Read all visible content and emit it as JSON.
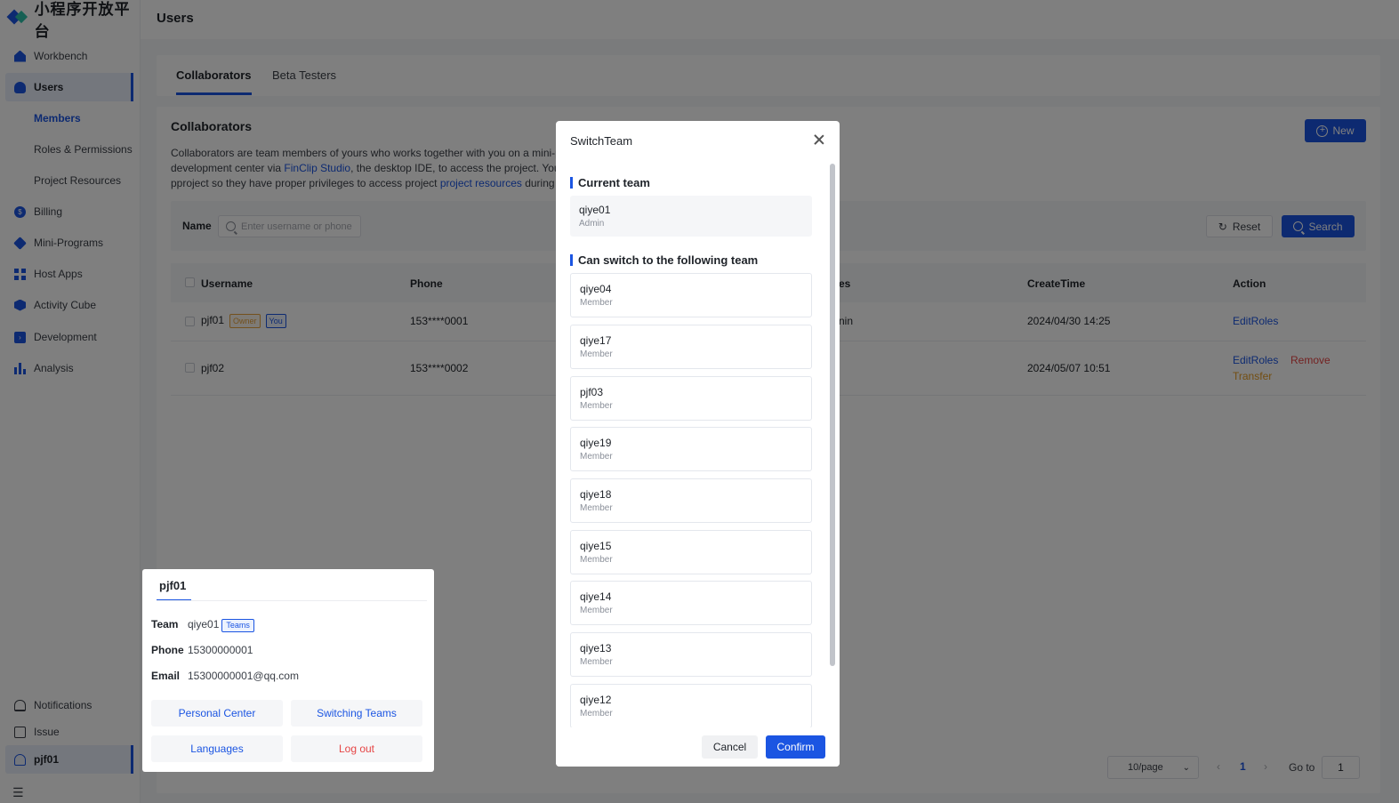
{
  "brand": {
    "name": "小程序开放平台"
  },
  "sidebar": {
    "items": [
      {
        "label": "Workbench",
        "icon": "home-icon"
      },
      {
        "label": "Users",
        "icon": "user-icon"
      },
      {
        "label": "Billing",
        "icon": "coin-icon"
      },
      {
        "label": "Mini-Programs",
        "icon": "diamond-icon"
      },
      {
        "label": "Host Apps",
        "icon": "grid-icon"
      },
      {
        "label": "Activity Cube",
        "icon": "cube-icon"
      },
      {
        "label": "Development",
        "icon": "terminal-icon"
      },
      {
        "label": "Analysis",
        "icon": "bar-chart-icon"
      }
    ],
    "sub_items": [
      "Members",
      "Roles & Permissions",
      "Project Resources"
    ],
    "bottom": [
      {
        "label": "Notifications",
        "icon": "bell-icon"
      },
      {
        "label": "Issue",
        "icon": "clipboard-icon"
      },
      {
        "label": "pjf01",
        "icon": "person-icon"
      }
    ]
  },
  "header": {
    "title": "Users"
  },
  "tabs": [
    "Collaborators",
    "Beta Testers"
  ],
  "collaborators": {
    "title": "Collaborators",
    "desc_1": "Collaborators are team members of yours who works together with you on a mini-p",
    "desc_2a": "development center via ",
    "desc_link1": "FinClip Studio",
    "desc_2b": ", the desktop IDE, to access the project. You",
    "desc_3a": "pproject so they have proper privileges to access project ",
    "desc_link2": "project resources",
    "desc_3b": " during t",
    "new_label": "New"
  },
  "filter": {
    "name_label": "Name",
    "placeholder": "Enter username or phone",
    "reset_label": "Reset",
    "search_label": "Search"
  },
  "table": {
    "headers": [
      "Username",
      "Phone",
      "es",
      "CreateTime",
      "Action"
    ],
    "rows": [
      {
        "username": "pjf01",
        "tag_owner": "Owner",
        "tag_you": "You",
        "phone": "153****0001",
        "role": "nin",
        "create_time": "2024/04/30 14:25",
        "action_edit": "EditRoles"
      },
      {
        "username": "pjf02",
        "phone": "153****0002",
        "create_time": "2024/05/07 10:51",
        "action_edit": "EditRoles",
        "action_remove": "Remove",
        "action_transfer": "Transfer"
      }
    ]
  },
  "pagination": {
    "page_size": "10/page",
    "prev": "‹",
    "current": "1",
    "next": "›",
    "goto_label": "Go to",
    "goto_value": "1"
  },
  "user_popover": {
    "name": "pjf01",
    "team_label": "Team",
    "team_value": "qiye01",
    "teams_tag": "Teams",
    "phone_label": "Phone",
    "phone_value": "15300000001",
    "email_label": "Email",
    "email_value": "15300000001@qq.com",
    "buttons": [
      "Personal Center",
      "Switching Teams",
      "Languages",
      "Log out"
    ]
  },
  "modal": {
    "title": "SwitchTeam",
    "current_section": "Current team",
    "current_team": {
      "name": "qiye01",
      "role": "Admin"
    },
    "switch_section": "Can switch to the following team",
    "teams": [
      {
        "name": "qiye04",
        "role": "Member"
      },
      {
        "name": "qiye17",
        "role": "Member"
      },
      {
        "name": "pjf03",
        "role": "Member"
      },
      {
        "name": "qiye19",
        "role": "Member"
      },
      {
        "name": "qiye18",
        "role": "Member"
      },
      {
        "name": "qiye15",
        "role": "Member"
      },
      {
        "name": "qiye14",
        "role": "Member"
      },
      {
        "name": "qiye13",
        "role": "Member"
      },
      {
        "name": "qiye12",
        "role": "Member"
      }
    ],
    "cancel_label": "Cancel",
    "confirm_label": "Confirm"
  },
  "colors": {
    "primary": "#1b55e2",
    "danger": "#e64545",
    "warning": "#e69c24"
  }
}
